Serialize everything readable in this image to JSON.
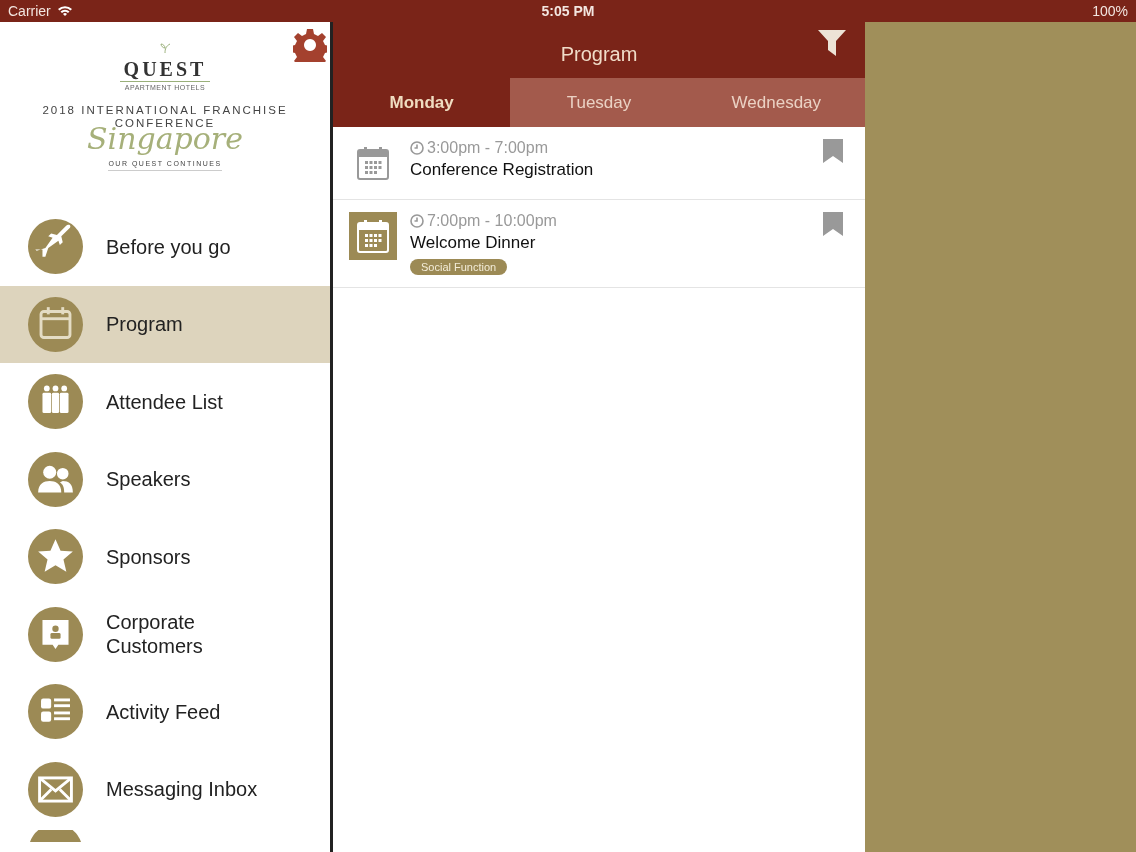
{
  "status_bar": {
    "carrier": "Carrier",
    "time": "5:05 PM",
    "battery": "100%"
  },
  "sidebar": {
    "logo": {
      "brand": "QUEST",
      "brand_sub": "APARTMENT HOTELS",
      "event_line_1": "2018 INTERNATIONAL FRANCHISE",
      "event_line_2": "CONFERENCE",
      "city": "Singapore",
      "tagline": "OUR QUEST CONTINUES"
    },
    "items": [
      {
        "label": "Before you go",
        "kind": "plane",
        "selected": false
      },
      {
        "label": "Program",
        "kind": "calendar",
        "selected": true
      },
      {
        "label": "Attendee List",
        "kind": "group",
        "selected": false
      },
      {
        "label": "Speakers",
        "kind": "people",
        "selected": false
      },
      {
        "label": "Sponsors",
        "kind": "star",
        "selected": false
      },
      {
        "label": "Corporate\nCustomers",
        "kind": "badge",
        "selected": false
      },
      {
        "label": "Activity Feed",
        "kind": "list",
        "selected": false
      },
      {
        "label": "Messaging Inbox",
        "kind": "mail",
        "selected": false
      }
    ]
  },
  "header": {
    "title": "Program"
  },
  "tabs": [
    {
      "label": "Monday",
      "selected": true
    },
    {
      "label": "Tuesday",
      "selected": false
    },
    {
      "label": "Wednesday",
      "selected": false
    }
  ],
  "events": [
    {
      "time": "3:00pm - 7:00pm",
      "title": "Conference Registration",
      "kind": "plain"
    },
    {
      "time": "7:00pm - 10:00pm",
      "title": "Welcome Dinner",
      "kind": "highlighted",
      "tag": "Social Function"
    }
  ]
}
